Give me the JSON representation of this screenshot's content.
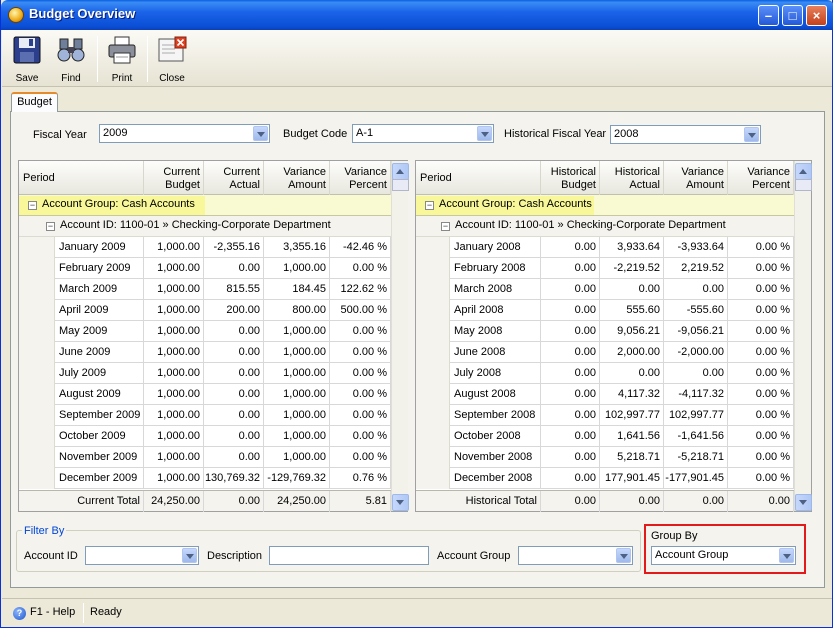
{
  "window": {
    "title": "Budget Overview"
  },
  "toolbar": [
    {
      "label": "Save",
      "icon": "floppy-disk-icon"
    },
    {
      "label": "Find",
      "icon": "binoculars-icon"
    },
    {
      "label": "Print",
      "icon": "printer-icon"
    },
    {
      "label": "Close",
      "icon": "close-document-icon"
    }
  ],
  "tab": {
    "label": "Budget"
  },
  "filters_top": {
    "fiscal_year_label": "Fiscal Year",
    "fiscal_year_value": "2009",
    "budget_code_label": "Budget Code",
    "budget_code_value": "A-1",
    "historical_label": "Historical Fiscal Year",
    "historical_value": "2008"
  },
  "left_grid": {
    "headers": [
      "Period",
      "Current\nBudget",
      "Current\nActual",
      "Variance\nAmount",
      "Variance\nPercent"
    ],
    "group_label": "Account Group: Cash Accounts",
    "account_label": "Account ID: 1100-01 » Checking-Corporate Department",
    "rows": [
      [
        "January 2009",
        "1,000.00",
        "-2,355.16",
        "3,355.16",
        "-42.46 %"
      ],
      [
        "February 2009",
        "1,000.00",
        "0.00",
        "1,000.00",
        "0.00 %"
      ],
      [
        "March 2009",
        "1,000.00",
        "815.55",
        "184.45",
        "122.62 %"
      ],
      [
        "April 2009",
        "1,000.00",
        "200.00",
        "800.00",
        "500.00 %"
      ],
      [
        "May 2009",
        "1,000.00",
        "0.00",
        "1,000.00",
        "0.00 %"
      ],
      [
        "June 2009",
        "1,000.00",
        "0.00",
        "1,000.00",
        "0.00 %"
      ],
      [
        "July 2009",
        "1,000.00",
        "0.00",
        "1,000.00",
        "0.00 %"
      ],
      [
        "August 2009",
        "1,000.00",
        "0.00",
        "1,000.00",
        "0.00 %"
      ],
      [
        "September 2009",
        "1,000.00",
        "0.00",
        "1,000.00",
        "0.00 %"
      ],
      [
        "October 2009",
        "1,000.00",
        "0.00",
        "1,000.00",
        "0.00 %"
      ],
      [
        "November 2009",
        "1,000.00",
        "0.00",
        "1,000.00",
        "0.00 %"
      ],
      [
        "December 2009",
        "1,000.00",
        "130,769.32",
        "-129,769.32",
        "0.76 %"
      ]
    ],
    "total": [
      "Current Total",
      "24,250.00",
      "0.00",
      "24,250.00",
      "5.81"
    ]
  },
  "right_grid": {
    "headers": [
      "Period",
      "Historical\nBudget",
      "Historical\nActual",
      "Variance\nAmount",
      "Variance\nPercent"
    ],
    "group_label": "Account Group: Cash Accounts",
    "account_label": "Account ID: 1100-01 » Checking-Corporate Department",
    "rows": [
      [
        "January 2008",
        "0.00",
        "3,933.64",
        "-3,933.64",
        "0.00 %"
      ],
      [
        "February 2008",
        "0.00",
        "-2,219.52",
        "2,219.52",
        "0.00 %"
      ],
      [
        "March 2008",
        "0.00",
        "0.00",
        "0.00",
        "0.00 %"
      ],
      [
        "April 2008",
        "0.00",
        "555.60",
        "-555.60",
        "0.00 %"
      ],
      [
        "May 2008",
        "0.00",
        "9,056.21",
        "-9,056.21",
        "0.00 %"
      ],
      [
        "June 2008",
        "0.00",
        "2,000.00",
        "-2,000.00",
        "0.00 %"
      ],
      [
        "July 2008",
        "0.00",
        "0.00",
        "0.00",
        "0.00 %"
      ],
      [
        "August 2008",
        "0.00",
        "4,117.32",
        "-4,117.32",
        "0.00 %"
      ],
      [
        "September 2008",
        "0.00",
        "102,997.77",
        "102,997.77",
        "0.00 %"
      ],
      [
        "October 2008",
        "0.00",
        "1,641.56",
        "-1,641.56",
        "0.00 %"
      ],
      [
        "November 2008",
        "0.00",
        "5,218.71",
        "-5,218.71",
        "0.00 %"
      ],
      [
        "December 2008",
        "0.00",
        "177,901.45",
        "-177,901.45",
        "0.00 %"
      ]
    ],
    "total": [
      "Historical Total",
      "0.00",
      "0.00",
      "0.00",
      "0.00"
    ]
  },
  "filter_by": {
    "legend": "Filter By",
    "account_id_label": "Account ID",
    "account_id_value": "",
    "description_label": "Description",
    "description_value": "",
    "account_group_label": "Account Group",
    "account_group_value": ""
  },
  "group_by": {
    "label": "Group By",
    "value": "Account Group"
  },
  "status": {
    "help": "F1 - Help",
    "text": "Ready"
  },
  "colors": {
    "group_highlight": "#f8f89a",
    "groupby_border": "#e31a1a",
    "title_blue": "#0a4fd6"
  }
}
